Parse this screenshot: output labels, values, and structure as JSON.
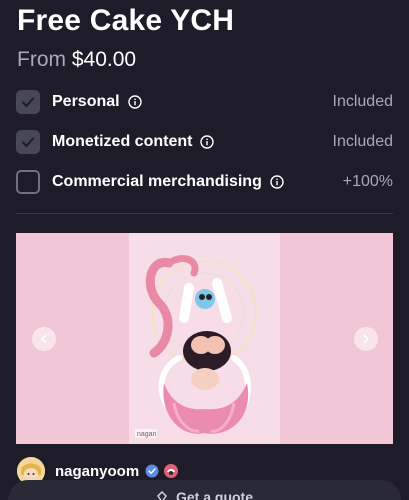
{
  "listing": {
    "title": "Free Cake YCH",
    "price_prefix": "From",
    "price": "$40.00"
  },
  "options": [
    {
      "label": "Personal",
      "value": "Included",
      "checked": true
    },
    {
      "label": "Monetized content",
      "value": "Included",
      "checked": true
    },
    {
      "label": "Commercial merchandising",
      "value": "+100%",
      "checked": false
    }
  ],
  "gallery": {
    "watermark": "nagan"
  },
  "artist": {
    "name": "naganyoom"
  },
  "footer": {
    "button_label": "Get a quote"
  },
  "colors": {
    "background": "#1d1c28",
    "muted_text": "#a9a8b6",
    "gallery_pink": "#f1c6d6",
    "verified_blue": "#5a8de6"
  },
  "icons": {
    "check": "check-icon",
    "info": "info-icon",
    "prev": "chevron-left-icon",
    "next": "chevron-right-icon",
    "verified": "verified-icon"
  }
}
